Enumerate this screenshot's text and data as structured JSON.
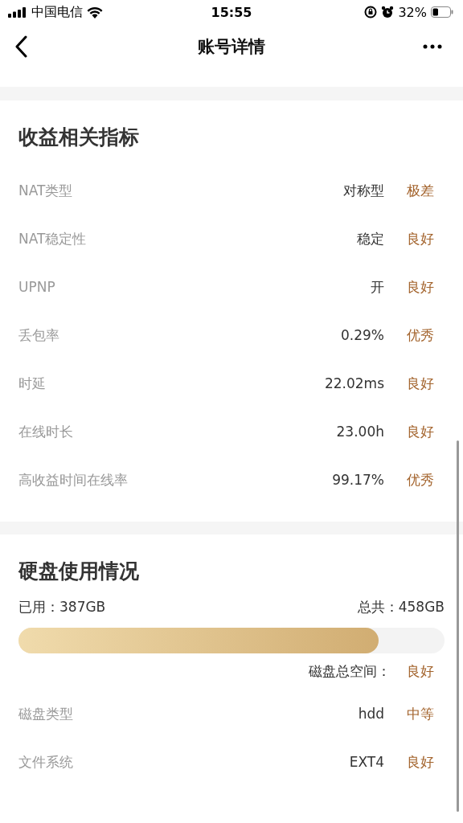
{
  "status_bar": {
    "carrier": "中国电信",
    "time": "15:55",
    "battery": "32%"
  },
  "nav": {
    "title": "账号详情"
  },
  "metrics": {
    "title": "收益相关指标",
    "rows": [
      {
        "label": "NAT类型",
        "value": "对称型",
        "rating": "极差"
      },
      {
        "label": "NAT稳定性",
        "value": "稳定",
        "rating": "良好"
      },
      {
        "label": "UPNP",
        "value": "开",
        "rating": "良好"
      },
      {
        "label": "丢包率",
        "value": "0.29%",
        "rating": "优秀"
      },
      {
        "label": "时延",
        "value": "22.02ms",
        "rating": "良好"
      },
      {
        "label": "在线时长",
        "value": "23.00h",
        "rating": "良好"
      },
      {
        "label": "高收益时间在线率",
        "value": "99.17%",
        "rating": "优秀"
      }
    ]
  },
  "disk": {
    "title": "硬盘使用情况",
    "used": "已用：387GB",
    "total": "总共：458GB",
    "level": 0.845,
    "space_label": "磁盘总空间：",
    "space_rating": "良好",
    "rows": [
      {
        "label": "磁盘类型",
        "value": "hdd",
        "rating": "中等"
      },
      {
        "label": "文件系统",
        "value": "EXT4",
        "rating": "良好"
      }
    ]
  }
}
